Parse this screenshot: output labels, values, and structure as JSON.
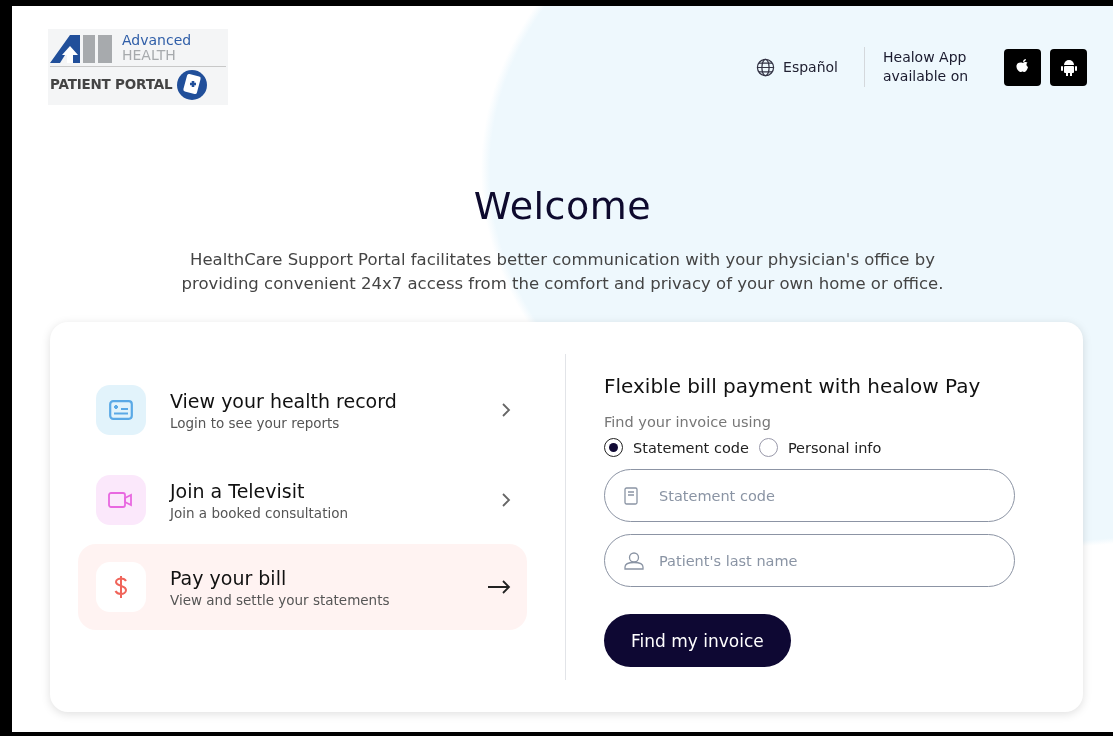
{
  "logo": {
    "line1": "Advanced",
    "line2": "HEALTH",
    "line3": "PATIENT PORTAL"
  },
  "header": {
    "language": "Español",
    "app_text": "Healow App available on",
    "stores": [
      {
        "kind": "apple"
      },
      {
        "kind": "android"
      }
    ]
  },
  "hero": {
    "title": "Welcome",
    "description": "HealthCare Support Portal facilitates better communication with your physician's office by providing convenient 24x7 access from the comfort and privacy of your own home or office."
  },
  "actions": [
    {
      "kind": "record",
      "color": "#5aa9e6",
      "title": "View your health record",
      "subtitle": "Login to see your reports",
      "selected": false
    },
    {
      "kind": "video",
      "color": "#e868e0",
      "title": "Join a Televisit",
      "subtitle": "Join a booked consultation",
      "selected": false
    },
    {
      "kind": "bill",
      "color": "#f0645a",
      "title": "Pay your bill",
      "subtitle": "View and settle your statements",
      "selected": true
    }
  ],
  "payment": {
    "title": "Flexible bill payment with healow Pay",
    "prompt": "Find your invoice using",
    "options": [
      {
        "label": "Statement code",
        "selected": true
      },
      {
        "label": "Personal info",
        "selected": false
      }
    ],
    "fields": [
      {
        "kind": "document",
        "placeholder": "Statement code"
      },
      {
        "kind": "person",
        "placeholder": "Patient's last name"
      }
    ],
    "button": "Find my invoice"
  }
}
